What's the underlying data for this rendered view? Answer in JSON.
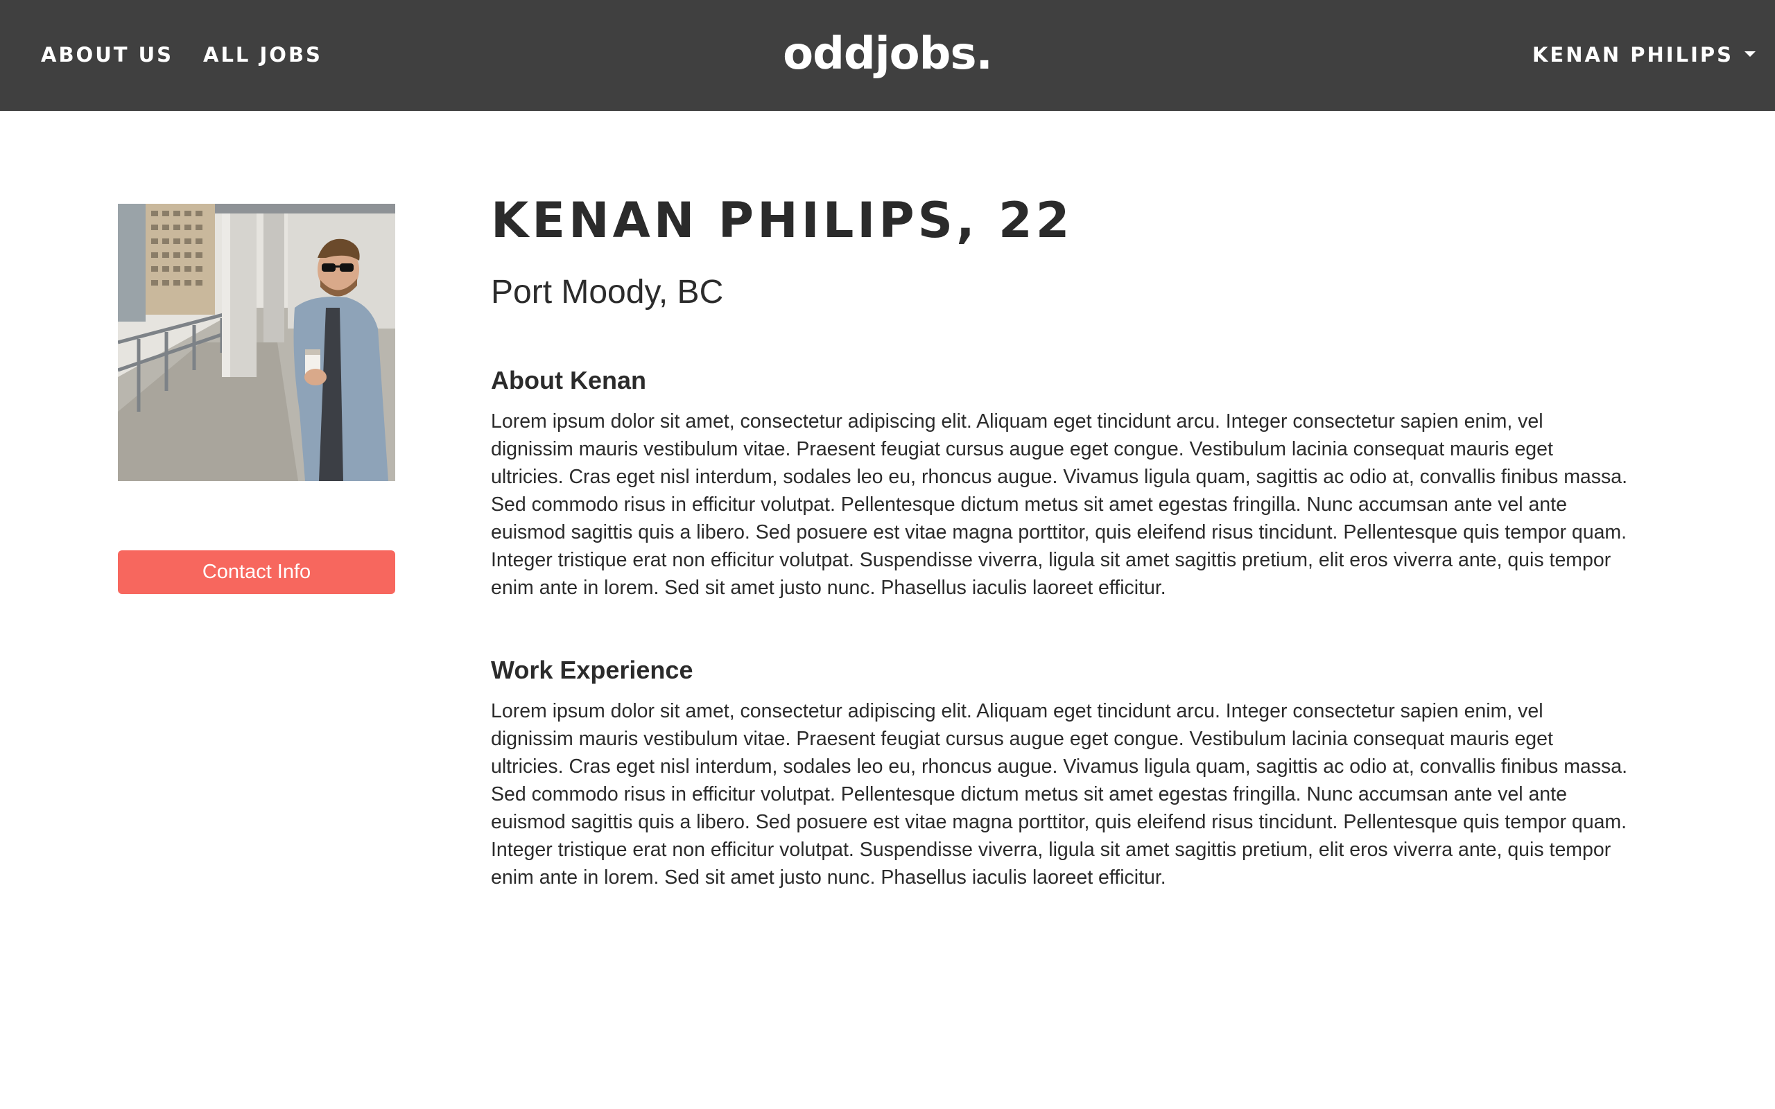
{
  "nav": {
    "about_label": "ABOUT US",
    "jobs_label": "ALL JOBS",
    "logo": "oddjobs.",
    "user_label": "KENAN PHILIPS"
  },
  "profile": {
    "title": "KENAN PHILIPS, 22",
    "location": "Port Moody, BC",
    "contact_label": "Contact Info",
    "photo_icon": "profile-photo"
  },
  "about": {
    "heading": "About Kenan",
    "body": "Lorem ipsum dolor sit amet, consectetur adipiscing elit. Aliquam eget tincidunt arcu. Integer consectetur sapien enim, vel dignissim mauris vestibulum vitae. Praesent feugiat cursus augue eget congue. Vestibulum lacinia consequat mauris eget ultricies. Cras eget nisl interdum, sodales leo eu, rhoncus augue. Vivamus ligula quam, sagittis ac odio at, convallis finibus massa. Sed commodo risus in efficitur volutpat. Pellentesque dictum metus sit amet egestas fringilla. Nunc accumsan ante vel ante euismod sagittis quis a libero. Sed posuere est vitae magna porttitor, quis eleifend risus tincidunt. Pellentesque quis tempor quam. Integer tristique erat non efficitur volutpat. Suspendisse viverra, ligula sit amet sagittis pretium, elit eros viverra ante, quis tempor enim ante in lorem. Sed sit amet justo nunc. Phasellus iaculis laoreet efficitur."
  },
  "work": {
    "heading": "Work Experience",
    "body": "Lorem ipsum dolor sit amet, consectetur adipiscing elit. Aliquam eget tincidunt arcu. Integer consectetur sapien enim, vel dignissim mauris vestibulum vitae. Praesent feugiat cursus augue eget congue. Vestibulum lacinia consequat mauris eget ultricies. Cras eget nisl interdum, sodales leo eu, rhoncus augue. Vivamus ligula quam, sagittis ac odio at, convallis finibus massa. Sed commodo risus in efficitur volutpat. Pellentesque dictum metus sit amet egestas fringilla. Nunc accumsan ante vel ante euismod sagittis quis a libero. Sed posuere est vitae magna porttitor, quis eleifend risus tincidunt. Pellentesque quis tempor quam. Integer tristique erat non efficitur volutpat. Suspendisse viverra, ligula sit amet sagittis pretium, elit eros viverra ante, quis tempor enim ante in lorem. Sed sit amet justo nunc. Phasellus iaculis laoreet efficitur."
  },
  "colors": {
    "navbar": "#404040",
    "accent": "#f7675e",
    "text": "#2b2b2b"
  }
}
